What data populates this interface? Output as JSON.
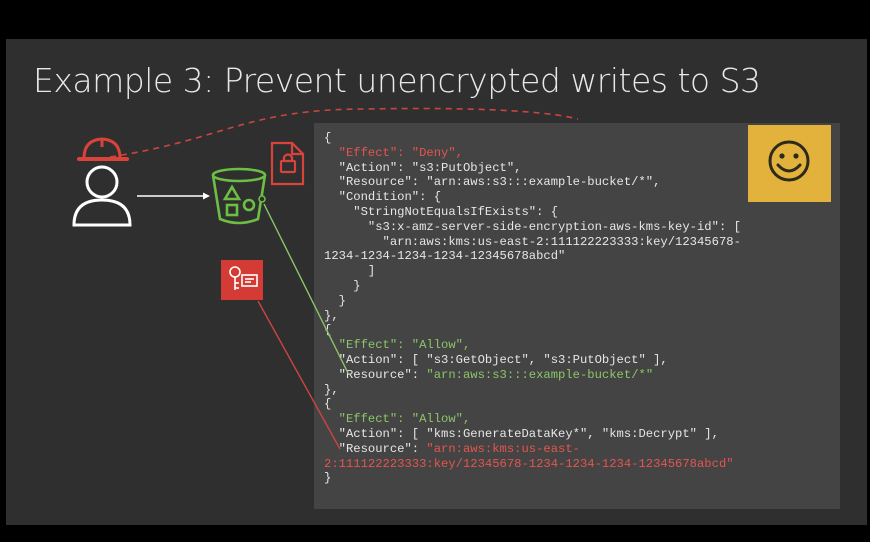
{
  "slide": {
    "title": "Example 3: Prevent unencrypted writes to S3"
  },
  "icons": {
    "user": "user-icon",
    "hard_hat": "hard-hat-icon",
    "bucket": "s3-bucket-icon",
    "lock_doc": "locked-document-icon",
    "key": "kms-key-icon",
    "smiley": "smiley-face-icon"
  },
  "colors": {
    "background": "#2f2f2f",
    "code_panel": "#444444",
    "deny_red": "#e4554f",
    "allow_green": "#8cc56a",
    "bucket_green": "#6cbf43",
    "smiley_box": "#e3b23c"
  },
  "policy": {
    "s1": {
      "open": "{",
      "effect": "  \"Effect\": \"Deny\",",
      "action": "  \"Action\": \"s3:PutObject\",",
      "resource": "  \"Resource\": \"arn:aws:s3:::example-bucket/*\",",
      "condition": "  \"Condition\": {",
      "op": "    \"StringNotEqualsIfExists\": {",
      "key": "      \"s3:x-amz-server-side-encryption-aws-kms-key-id\": [",
      "arn_a": "        \"arn:aws:kms:us-east-2:111122223333:key/12345678-",
      "arn_b": "1234-1234-1234-1234-12345678abcd\"",
      "c1": "      ]",
      "c2": "    }",
      "c3": "  }",
      "close": "},"
    },
    "s2": {
      "open": "{",
      "effect": "  \"Effect\": \"Allow\",",
      "action": "  \"Action\": [ \"s3:GetObject\", \"s3:PutObject\" ],",
      "resource_key": "  \"Resource\": ",
      "resource_val": "\"arn:aws:s3:::example-bucket/*\"",
      "close": "},"
    },
    "s3": {
      "open": "{",
      "effect": "  \"Effect\": \"Allow\",",
      "action": "  \"Action\": [ \"kms:GenerateDataKey*\", \"kms:Decrypt\" ],",
      "resource_key": "  \"Resource\": ",
      "resource_val_a": "\"arn:aws:kms:us-east-",
      "resource_val_b": "2:111122223333:key/12345678-1234-1234-1234-12345678abcd\"",
      "close": "}"
    }
  }
}
